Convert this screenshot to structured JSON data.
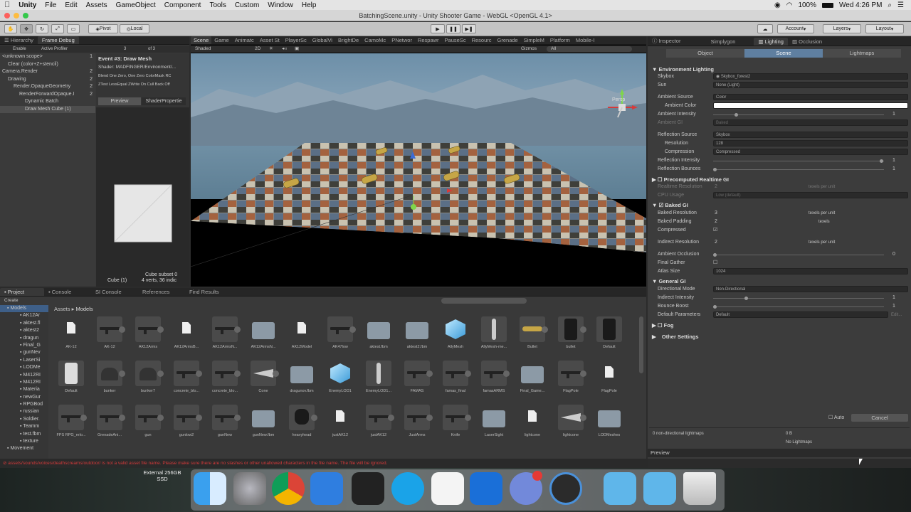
{
  "menubar": {
    "apple": "",
    "app": "Unity",
    "items": [
      "File",
      "Edit",
      "Assets",
      "GameObject",
      "Component",
      "Tools",
      "Custom",
      "Window",
      "Help"
    ],
    "battery": "100%",
    "clock": "Wed 4:26 PM"
  },
  "title": "BatchingScene.unity - Unity Shooter Game - WebGL <OpenGL 4.1>",
  "toolbar": {
    "pivot": "Pivot",
    "local": "Local",
    "account": "Account",
    "layers": "Layers",
    "layout": "Layout"
  },
  "left": {
    "tabs": [
      "Hierarchy",
      "Frame Debug"
    ],
    "enable": "Enable",
    "profiler": "Active Profiler",
    "frame_num": "3",
    "of": "of 3",
    "tree": [
      {
        "label": "<unknown scope>",
        "count": "1",
        "indent": 0
      },
      {
        "label": "Clear (color+Z+stencil)",
        "count": "",
        "indent": 1
      },
      {
        "label": "Camera.Render",
        "count": "2",
        "indent": 0
      },
      {
        "label": "Drawing",
        "count": "2",
        "indent": 1
      },
      {
        "label": "Render.OpaqueGeometry",
        "count": "2",
        "indent": 2
      },
      {
        "label": "RenderForwardOpaque.I",
        "count": "2",
        "indent": 3
      },
      {
        "label": "Dynamic Batch",
        "count": "",
        "indent": 4
      },
      {
        "label": "Draw Mesh Cube (1)",
        "count": "",
        "indent": 4
      }
    ],
    "event_title": "Event #3: Draw Mesh",
    "shader": "Shader: MADFINGER/Environment/...",
    "blend": "Blend One Zero, One Zero ColorMask RC",
    "ztest": "ZTest LessEqual ZWrite On Cull Back Off",
    "preview_tab": "Preview",
    "shader_props_tab": "ShaderPropertie",
    "cube_label": "Cube (1)",
    "subset": "Cube subset 0",
    "verts": "4 verts, 36 indic"
  },
  "scene": {
    "tabs": [
      "Scene",
      "Game",
      "Animatc",
      "Asset St",
      "PlayerSc",
      "GlobalVi",
      "BrightDe",
      "CamoMc",
      "PNetwor",
      "Respawr",
      "PauseSc",
      "Resourc",
      "Grenade",
      "SimpleM",
      "Platform",
      "Mobile-I"
    ],
    "shaded": "Shaded",
    "twod": "2D",
    "gizmos": "Gizmos",
    "all": "All",
    "persp": "Persp"
  },
  "inspector": {
    "tabs": [
      "Inspector",
      "Simplygon",
      "Lighting",
      "Occlusion"
    ],
    "subtabs": [
      "Object",
      "Scene",
      "Lightmaps"
    ],
    "env_title": "Environment Lighting",
    "skybox_label": "Skybox",
    "skybox_value": "Skybox_forest2",
    "sun_label": "Sun",
    "sun_value": "None (Light)",
    "amb_source_label": "Ambient Source",
    "amb_source_value": "Color",
    "amb_color_label": "Ambient Color",
    "amb_int_label": "Ambient Intensity",
    "amb_int_value": "1",
    "amb_gi_label": "Ambient GI",
    "amb_gi_value": "Baked",
    "refl_source_label": "Reflection Source",
    "refl_source_value": "Skybox",
    "resolution_label": "Resolution",
    "resolution_value": "128",
    "compression_label": "Compression",
    "compression_value": "Compressed",
    "refl_int_label": "Reflection Intensity",
    "refl_int_value": "1",
    "refl_bounce_label": "Reflection Bounces",
    "refl_bounce_value": "1",
    "precomp_title": "Precomputed Realtime GI",
    "rt_res_label": "Realtime Resolution",
    "rt_res_value": "2",
    "texels": "texels per unit",
    "cpu_label": "CPU Usage",
    "cpu_value": "Low (default)",
    "baked_title": "Baked GI",
    "baked_res_label": "Baked Resolution",
    "baked_res_value": "3",
    "baked_pad_label": "Baked Padding",
    "baked_pad_value": "2",
    "texels_short": "texels",
    "compressed_label": "Compressed",
    "indirect_res_label": "Indirect Resolution",
    "indirect_res_value": "2",
    "ao_label": "Ambient Occlusion",
    "ao_value": "0",
    "final_gather_label": "Final Gather",
    "atlas_label": "Atlas Size",
    "atlas_value": "1024",
    "general_title": "General GI",
    "dir_mode_label": "Directional Mode",
    "dir_mode_value": "Non-Directional",
    "indirect_int_label": "Indirect Intensity",
    "indirect_int_value": "1",
    "bounce_label": "Bounce Boost",
    "bounce_value": "1",
    "default_params_label": "Default Parameters",
    "default_params_value": "Default",
    "edit_label": "Edit...",
    "fog_label": "Fog",
    "other_label": "Other Settings",
    "auto_label": "Auto",
    "cancel_label": "Cancel",
    "lightmaps_info": "0 non-directional lightmaps",
    "lightmaps_size": "0 B",
    "no_lightmaps": "No Lightmaps",
    "preview_label": "Preview"
  },
  "project": {
    "tabs": [
      "Project",
      "Console",
      "SI Console",
      "References",
      "Find Results"
    ],
    "create": "Create",
    "breadcrumb_root": "Assets",
    "breadcrumb_sep": "▸",
    "breadcrumb_leaf": "Models",
    "tree": [
      "Models",
      "AK12Ar",
      "aktest.fl",
      "aktest2",
      "dragun",
      "Final_G",
      "gunNev",
      "LaserSi",
      "LODMe",
      "M412RI",
      "M412RI",
      "Materia",
      "newGur",
      "RPGBod",
      "russian",
      "Soldier.",
      "Teamm",
      "test.fbm",
      "texture",
      "Movement"
    ],
    "assets": [
      {
        "name": "AK-12",
        "kind": "file",
        "play": false
      },
      {
        "name": "AK-12",
        "kind": "gun",
        "play": true
      },
      {
        "name": "AK12Arms",
        "kind": "gun",
        "play": true
      },
      {
        "name": "AK12ArmsB...",
        "kind": "file",
        "play": false
      },
      {
        "name": "AK12ArmsN...",
        "kind": "gun",
        "play": true
      },
      {
        "name": "AK12ArmsN...",
        "kind": "folder",
        "play": false
      },
      {
        "name": "AK12Model",
        "kind": "file",
        "play": false
      },
      {
        "name": "AK47low",
        "kind": "gun",
        "play": true
      },
      {
        "name": "aktest.fbm",
        "kind": "folder",
        "play": false
      },
      {
        "name": "aktest2.fbm",
        "kind": "folder",
        "play": false
      },
      {
        "name": "AllyMesh",
        "kind": "cube",
        "play": false
      },
      {
        "name": "AllyMesh-me...",
        "kind": "figure",
        "play": false
      },
      {
        "name": "Bullet",
        "kind": "bullet",
        "play": true
      },
      {
        "name": "bullet",
        "kind": "can",
        "play": true
      },
      {
        "name": "Default",
        "kind": "can",
        "play": false
      },
      {
        "name": "Default",
        "kind": "can2",
        "play": false
      },
      {
        "name": "bunker",
        "kind": "bunker",
        "play": true
      },
      {
        "name": "bunker7",
        "kind": "bunker",
        "play": true
      },
      {
        "name": "concrete_blo...",
        "kind": "gun",
        "play": true
      },
      {
        "name": "concrete_blo...",
        "kind": "gun",
        "play": true
      },
      {
        "name": "Cone",
        "kind": "cone",
        "play": true
      },
      {
        "name": "dragunov.fbm",
        "kind": "folder",
        "play": false
      },
      {
        "name": "EnemyLOD1",
        "kind": "cube",
        "play": false
      },
      {
        "name": "EnemyLOD1...",
        "kind": "figure",
        "play": false
      },
      {
        "name": "FAMAS",
        "kind": "gun",
        "play": true
      },
      {
        "name": "famas_final",
        "kind": "gun",
        "play": true
      },
      {
        "name": "famasARMS",
        "kind": "gun",
        "play": true
      },
      {
        "name": "Final_Game...",
        "kind": "folder",
        "play": false
      },
      {
        "name": "FlagPole",
        "kind": "gun",
        "play": true
      },
      {
        "name": "FlagPole",
        "kind": "file",
        "play": false
      },
      {
        "name": "FPS RPG_relo...",
        "kind": "gun",
        "play": true
      },
      {
        "name": "GrenadeAni...",
        "kind": "gun",
        "play": true
      },
      {
        "name": "gun",
        "kind": "gun",
        "play": true
      },
      {
        "name": "gunlow2",
        "kind": "gun",
        "play": true
      },
      {
        "name": "gunNew",
        "kind": "gun",
        "play": true
      },
      {
        "name": "gunNew.fbm",
        "kind": "folder",
        "play": false
      },
      {
        "name": "heavyhead",
        "kind": "head",
        "play": true
      },
      {
        "name": "justAK12",
        "kind": "file",
        "play": false
      },
      {
        "name": "justAK12",
        "kind": "gun",
        "play": true
      },
      {
        "name": "JustArms",
        "kind": "gun",
        "play": true
      },
      {
        "name": "Knife",
        "kind": "gun",
        "play": true
      },
      {
        "name": "LaserSight",
        "kind": "folder",
        "play": false
      },
      {
        "name": "lightcone",
        "kind": "file",
        "play": false
      },
      {
        "name": "lightcone",
        "kind": "cone",
        "play": true
      },
      {
        "name": "LODMeshes",
        "kind": "folder",
        "play": false
      }
    ]
  },
  "status": {
    "error": "assets/sounds/voices/deathscreams/outdoor/ is not a valid asset file name. Please make sure there are no slashes or other unallowed characters in the file name. The file will be ignored."
  },
  "dock": {
    "drive_label": "External 256GB",
    "drive_sub": "SSD"
  }
}
